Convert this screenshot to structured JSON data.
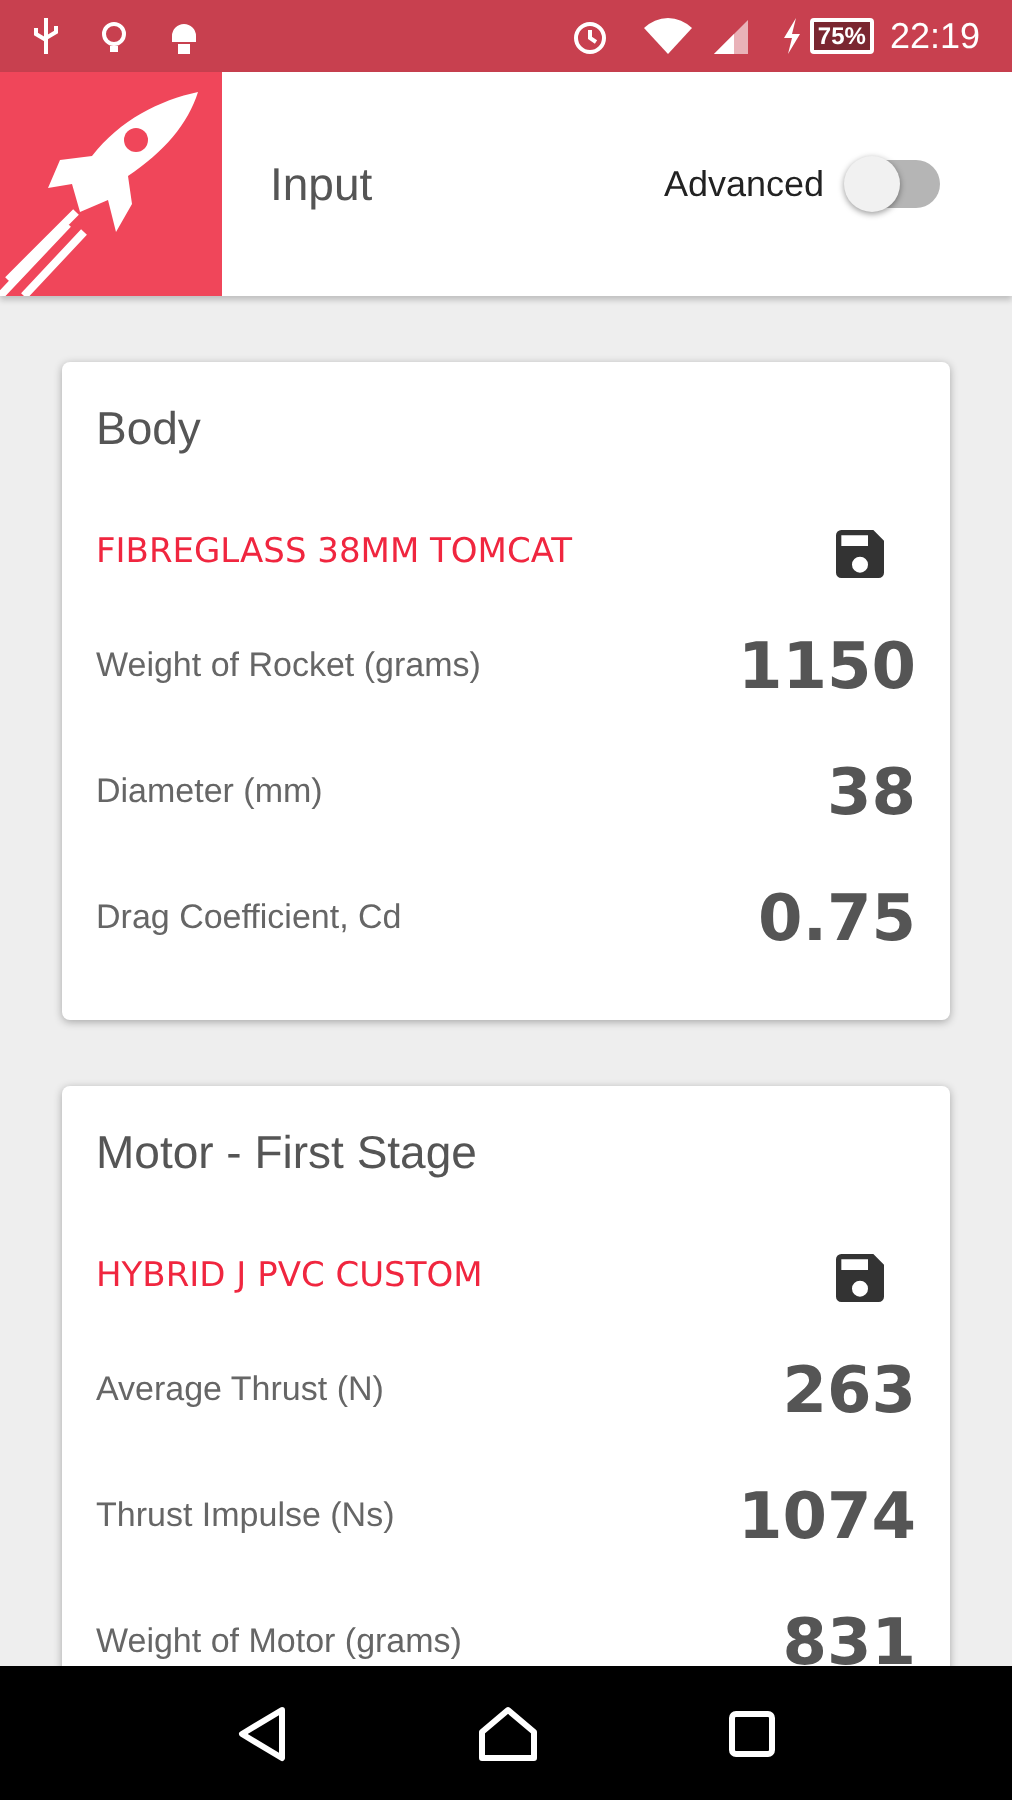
{
  "status_bar": {
    "battery": "75%",
    "time": "22:19"
  },
  "header": {
    "title": "Input",
    "advanced": {
      "label": "Advanced",
      "on": false
    }
  },
  "cards": [
    {
      "title": "Body",
      "preset": "FIBREGLASS 38MM TOMCAT",
      "fields": [
        {
          "label": "Weight of Rocket (grams)",
          "value": "1150"
        },
        {
          "label": "Diameter (mm)",
          "value": "38"
        },
        {
          "label": "Drag Coefficient, Cd",
          "value": "0.75"
        }
      ]
    },
    {
      "title": "Motor - First Stage",
      "preset": "HYBRID J PVC CUSTOM",
      "fields": [
        {
          "label": "Average Thrust (N)",
          "value": "263"
        },
        {
          "label": "Thrust Impulse (Ns)",
          "value": "1074"
        },
        {
          "label": "Weight of Motor (grams)",
          "value": "831"
        }
      ]
    }
  ]
}
